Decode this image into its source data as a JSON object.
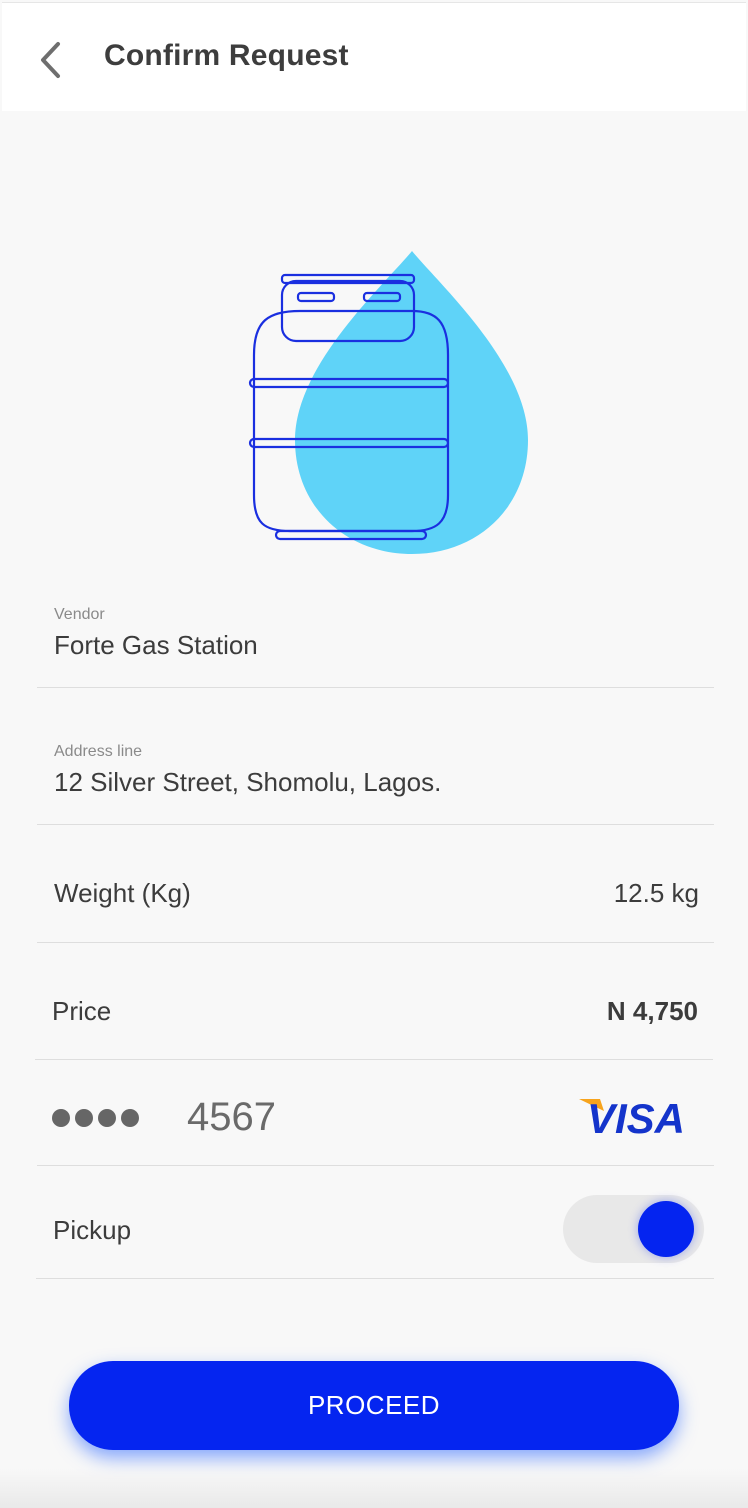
{
  "header": {
    "title": "Confirm Request",
    "back_icon": "chevron-left-icon"
  },
  "illustration": {
    "icon": "gas-cylinder-icon",
    "drop_color": "#5fd3f8",
    "outline_color": "#1a2fe0"
  },
  "vendor": {
    "label": "Vendor",
    "value": "Forte Gas Station"
  },
  "address": {
    "label": "Address line",
    "value": "12 Silver Street, Shomolu, Lagos."
  },
  "weight": {
    "label": "Weight (Kg)",
    "value": "12.5 kg"
  },
  "price": {
    "label": "Price",
    "value": "N 4,750"
  },
  "card": {
    "masked": "●●●●",
    "last4": "4567",
    "brand": "VISA",
    "brand_icon": "visa-logo-icon"
  },
  "pickup": {
    "label": "Pickup",
    "enabled": true
  },
  "actions": {
    "proceed_label": "PROCEED"
  },
  "colors": {
    "accent": "#0525f0",
    "background": "#f8f8f8",
    "visa_blue": "#1434cb",
    "visa_gold": "#f7a41d"
  }
}
